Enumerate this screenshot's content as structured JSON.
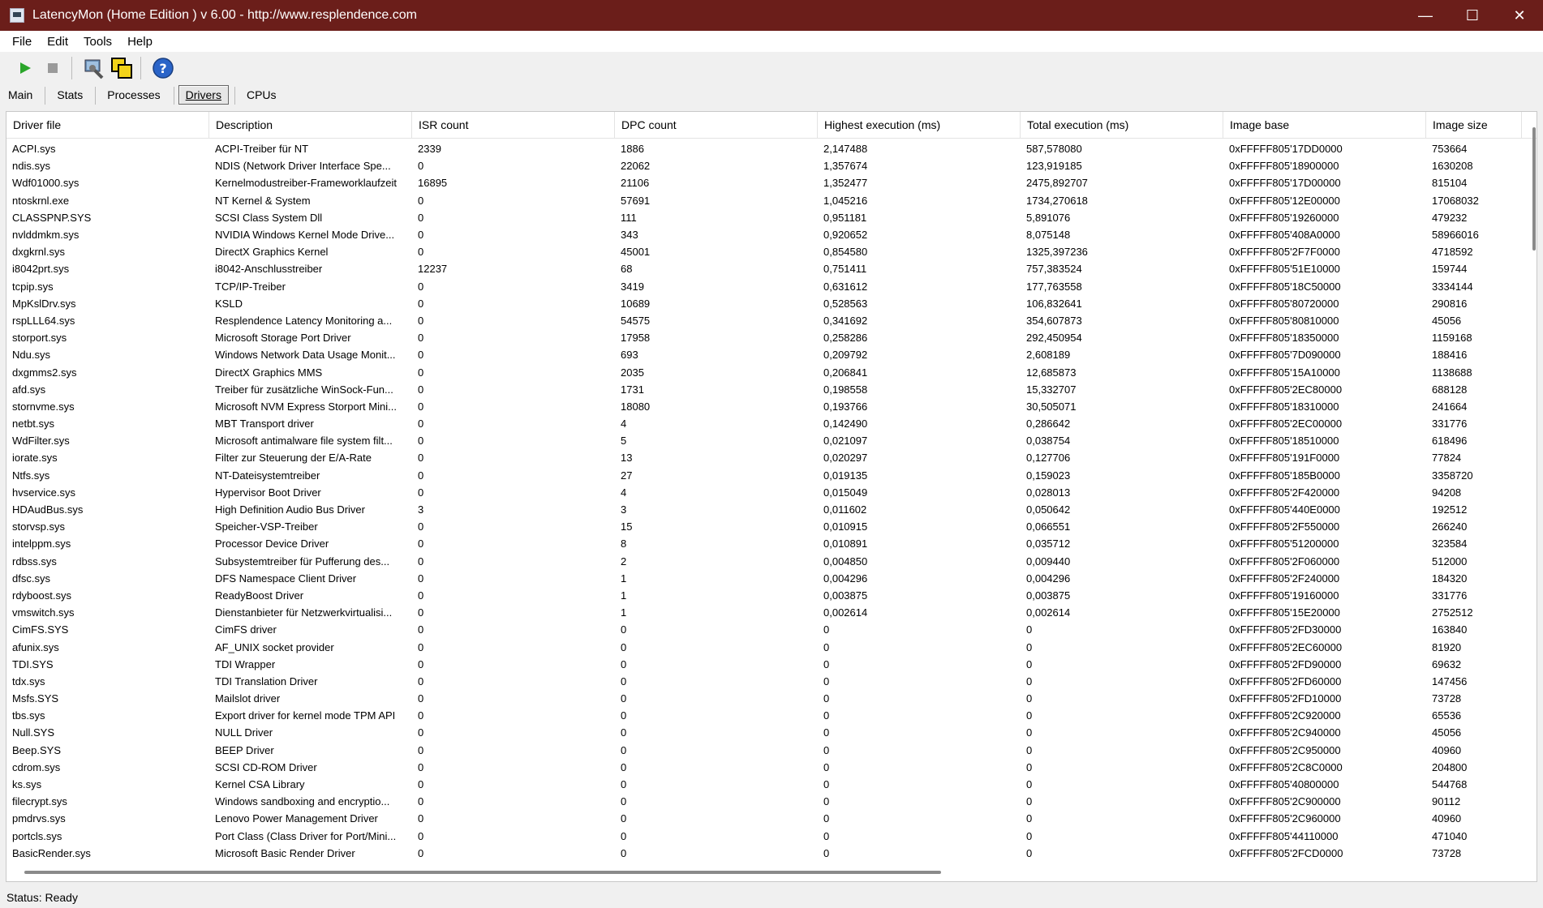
{
  "window": {
    "title": "LatencyMon  (Home Edition )  v 6.00 - http://www.resplendence.com",
    "minimize": "—",
    "maximize": "☐",
    "close": "✕"
  },
  "menu": [
    "File",
    "Edit",
    "Tools",
    "Help"
  ],
  "toolbar": {
    "icons": [
      "play-icon",
      "stop-icon",
      "options-icon",
      "window-icon",
      "help-icon"
    ],
    "accent_green": "#2aa52a",
    "help_blue": "#2a64c8"
  },
  "tabs": [
    "Main",
    "Stats",
    "Processes",
    "Drivers",
    "CPUs"
  ],
  "active_tab": "Drivers",
  "table": {
    "columns": [
      "Driver file",
      "Description",
      "ISR count",
      "DPC count",
      "Highest execution (ms)",
      "Total execution (ms)",
      "Image base",
      "Image size"
    ],
    "rows": [
      [
        "ACPI.sys",
        "ACPI-Treiber für NT",
        "2339",
        "1886",
        "2,147488",
        "587,578080",
        "0xFFFFF805'17DD0000",
        "753664"
      ],
      [
        "ndis.sys",
        "NDIS (Network Driver Interface Spe...",
        "0",
        "22062",
        "1,357674",
        "123,919185",
        "0xFFFFF805'18900000",
        "1630208"
      ],
      [
        "Wdf01000.sys",
        "Kernelmodustreiber-Frameworklaufzeit",
        "16895",
        "21106",
        "1,352477",
        "2475,892707",
        "0xFFFFF805'17D00000",
        "815104"
      ],
      [
        "ntoskrnl.exe",
        "NT Kernel & System",
        "0",
        "57691",
        "1,045216",
        "1734,270618",
        "0xFFFFF805'12E00000",
        "17068032"
      ],
      [
        "CLASSPNP.SYS",
        "SCSI Class System Dll",
        "0",
        "111",
        "0,951181",
        "5,891076",
        "0xFFFFF805'19260000",
        "479232"
      ],
      [
        "nvlddmkm.sys",
        "NVIDIA Windows Kernel Mode Drive...",
        "0",
        "343",
        "0,920652",
        "8,075148",
        "0xFFFFF805'408A0000",
        "58966016"
      ],
      [
        "dxgkrnl.sys",
        "DirectX Graphics Kernel",
        "0",
        "45001",
        "0,854580",
        "1325,397236",
        "0xFFFFF805'2F7F0000",
        "4718592"
      ],
      [
        "i8042prt.sys",
        "i8042-Anschlusstreiber",
        "12237",
        "68",
        "0,751411",
        "757,383524",
        "0xFFFFF805'51E10000",
        "159744"
      ],
      [
        "tcpip.sys",
        "TCP/IP-Treiber",
        "0",
        "3419",
        "0,631612",
        "177,763558",
        "0xFFFFF805'18C50000",
        "3334144"
      ],
      [
        "MpKslDrv.sys",
        "KSLD",
        "0",
        "10689",
        "0,528563",
        "106,832641",
        "0xFFFFF805'80720000",
        "290816"
      ],
      [
        "rspLLL64.sys",
        "Resplendence Latency Monitoring a...",
        "0",
        "54575",
        "0,341692",
        "354,607873",
        "0xFFFFF805'80810000",
        "45056"
      ],
      [
        "storport.sys",
        "Microsoft Storage Port Driver",
        "0",
        "17958",
        "0,258286",
        "292,450954",
        "0xFFFFF805'18350000",
        "1159168"
      ],
      [
        "Ndu.sys",
        "Windows Network Data Usage Monit...",
        "0",
        "693",
        "0,209792",
        "2,608189",
        "0xFFFFF805'7D090000",
        "188416"
      ],
      [
        "dxgmms2.sys",
        "DirectX Graphics MMS",
        "0",
        "2035",
        "0,206841",
        "12,685873",
        "0xFFFFF805'15A10000",
        "1138688"
      ],
      [
        "afd.sys",
        "Treiber für zusätzliche WinSock-Fun...",
        "0",
        "1731",
        "0,198558",
        "15,332707",
        "0xFFFFF805'2EC80000",
        "688128"
      ],
      [
        "stornvme.sys",
        "Microsoft NVM Express Storport Mini...",
        "0",
        "18080",
        "0,193766",
        "30,505071",
        "0xFFFFF805'18310000",
        "241664"
      ],
      [
        "netbt.sys",
        "MBT Transport driver",
        "0",
        "4",
        "0,142490",
        "0,286642",
        "0xFFFFF805'2EC00000",
        "331776"
      ],
      [
        "WdFilter.sys",
        "Microsoft antimalware file system filt...",
        "0",
        "5",
        "0,021097",
        "0,038754",
        "0xFFFFF805'18510000",
        "618496"
      ],
      [
        "iorate.sys",
        "Filter zur Steuerung der E/A-Rate",
        "0",
        "13",
        "0,020297",
        "0,127706",
        "0xFFFFF805'191F0000",
        "77824"
      ],
      [
        "Ntfs.sys",
        "NT-Dateisystemtreiber",
        "0",
        "27",
        "0,019135",
        "0,159023",
        "0xFFFFF805'185B0000",
        "3358720"
      ],
      [
        "hvservice.sys",
        "Hypervisor Boot Driver",
        "0",
        "4",
        "0,015049",
        "0,028013",
        "0xFFFFF805'2F420000",
        "94208"
      ],
      [
        "HDAudBus.sys",
        "High Definition Audio Bus Driver",
        "3",
        "3",
        "0,011602",
        "0,050642",
        "0xFFFFF805'440E0000",
        "192512"
      ],
      [
        "storvsp.sys",
        "Speicher-VSP-Treiber",
        "0",
        "15",
        "0,010915",
        "0,066551",
        "0xFFFFF805'2F550000",
        "266240"
      ],
      [
        "intelppm.sys",
        "Processor Device Driver",
        "0",
        "8",
        "0,010891",
        "0,035712",
        "0xFFFFF805'51200000",
        "323584"
      ],
      [
        "rdbss.sys",
        "Subsystemtreiber für Pufferung des...",
        "0",
        "2",
        "0,004850",
        "0,009440",
        "0xFFFFF805'2F060000",
        "512000"
      ],
      [
        "dfsc.sys",
        "DFS Namespace Client Driver",
        "0",
        "1",
        "0,004296",
        "0,004296",
        "0xFFFFF805'2F240000",
        "184320"
      ],
      [
        "rdyboost.sys",
        "ReadyBoost Driver",
        "0",
        "1",
        "0,003875",
        "0,003875",
        "0xFFFFF805'19160000",
        "331776"
      ],
      [
        "vmswitch.sys",
        "Dienstanbieter für Netzwerkvirtualisi...",
        "0",
        "1",
        "0,002614",
        "0,002614",
        "0xFFFFF805'15E20000",
        "2752512"
      ],
      [
        "CimFS.SYS",
        "CimFS driver",
        "0",
        "0",
        "0",
        "0",
        "0xFFFFF805'2FD30000",
        "163840"
      ],
      [
        "afunix.sys",
        "AF_UNIX socket provider",
        "0",
        "0",
        "0",
        "0",
        "0xFFFFF805'2EC60000",
        "81920"
      ],
      [
        "TDI.SYS",
        "TDI Wrapper",
        "0",
        "0",
        "0",
        "0",
        "0xFFFFF805'2FD90000",
        "69632"
      ],
      [
        "tdx.sys",
        "TDI Translation Driver",
        "0",
        "0",
        "0",
        "0",
        "0xFFFFF805'2FD60000",
        "147456"
      ],
      [
        "Msfs.SYS",
        "Mailslot driver",
        "0",
        "0",
        "0",
        "0",
        "0xFFFFF805'2FD10000",
        "73728"
      ],
      [
        "tbs.sys",
        "Export driver for kernel mode TPM API",
        "0",
        "0",
        "0",
        "0",
        "0xFFFFF805'2C920000",
        "65536"
      ],
      [
        "Null.SYS",
        "NULL Driver",
        "0",
        "0",
        "0",
        "0",
        "0xFFFFF805'2C940000",
        "45056"
      ],
      [
        "Beep.SYS",
        "BEEP Driver",
        "0",
        "0",
        "0",
        "0",
        "0xFFFFF805'2C950000",
        "40960"
      ],
      [
        "cdrom.sys",
        "SCSI CD-ROM Driver",
        "0",
        "0",
        "0",
        "0",
        "0xFFFFF805'2C8C0000",
        "204800"
      ],
      [
        "ks.sys",
        "Kernel CSA Library",
        "0",
        "0",
        "0",
        "0",
        "0xFFFFF805'40800000",
        "544768"
      ],
      [
        "filecrypt.sys",
        "Windows sandboxing and encryptio...",
        "0",
        "0",
        "0",
        "0",
        "0xFFFFF805'2C900000",
        "90112"
      ],
      [
        "pmdrvs.sys",
        "Lenovo Power Management Driver",
        "0",
        "0",
        "0",
        "0",
        "0xFFFFF805'2C960000",
        "40960"
      ],
      [
        "portcls.sys",
        "Port Class (Class Driver for Port/Mini...",
        "0",
        "0",
        "0",
        "0",
        "0xFFFFF805'44110000",
        "471040"
      ],
      [
        "BasicRender.sys",
        "Microsoft Basic Render Driver",
        "0",
        "0",
        "0",
        "0",
        "0xFFFFF805'2FCD0000",
        "73728"
      ]
    ]
  },
  "status": "Status: Ready"
}
